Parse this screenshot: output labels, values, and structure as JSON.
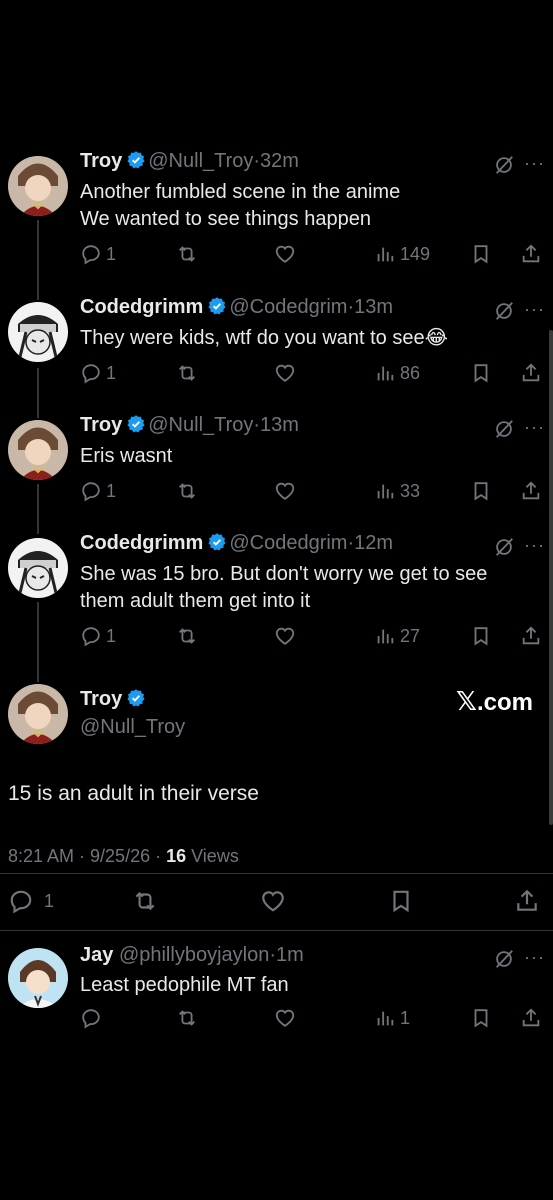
{
  "posts": [
    {
      "name": "Troy",
      "handle": "@Null_Troy",
      "time": "·32m",
      "text": "Another fumbled scene in the anime\nWe wanted to see things happen",
      "replies": "1",
      "views": "149"
    },
    {
      "name": "Codedgrimm",
      "handle": "@Codedgrim",
      "time": "·13m",
      "text": "They were kids, wtf do you want to see",
      "emoji": "😂",
      "replies": "1",
      "views": "86"
    },
    {
      "name": "Troy",
      "handle": "@Null_Troy",
      "time": "·13m",
      "text": "Eris wasnt",
      "replies": "1",
      "views": "33"
    },
    {
      "name": "Codedgrimm",
      "handle": "@Codedgrim",
      "time": "·12m",
      "text": "She was 15 bro. But don't worry we get to see\nthem adult them get into it",
      "replies": "1",
      "views": "27"
    }
  ],
  "main_post": {
    "name": "Troy",
    "handle": "@Null_Troy",
    "text": "15 is an adult in their verse",
    "timestamp": "8:21 AM · 9/25/26 · ",
    "views_count": "16",
    "views_label": " Views",
    "replies": "1"
  },
  "watermark": {
    "x_glyph": "𝕏",
    "domain": ".com"
  },
  "reply_post": {
    "name": "Jay",
    "handle": "@phillyboyjaylon",
    "time": "·1m",
    "text": "Least pedophile MT fan",
    "views": "1"
  },
  "more_glyph": "···",
  "colors": {
    "badge": "#1d9bf0",
    "muted": "#71767b",
    "text": "#e7e9ea"
  }
}
